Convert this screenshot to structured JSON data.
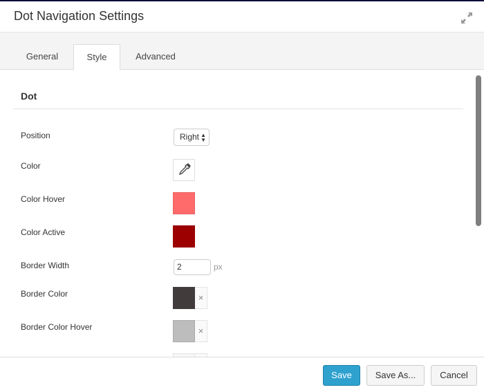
{
  "dialog": {
    "title": "Dot Navigation Settings",
    "expand_icon": "expand-arrows-icon"
  },
  "tabs": [
    {
      "label": "General",
      "active": false
    },
    {
      "label": "Style",
      "active": true
    },
    {
      "label": "Advanced",
      "active": false
    }
  ],
  "section": {
    "title": "Dot"
  },
  "fields": {
    "position": {
      "label": "Position",
      "value": "Right",
      "icon": "select-arrows-icon"
    },
    "color": {
      "label": "Color",
      "icon": "eyedropper-icon"
    },
    "color_hover": {
      "label": "Color Hover",
      "value": "#ff6b6b"
    },
    "color_active": {
      "label": "Color Active",
      "value": "#9c0000"
    },
    "border_width": {
      "label": "Border Width",
      "value": "2",
      "unit": "px"
    },
    "border_color": {
      "label": "Border Color",
      "value": "#423b3b",
      "clear": "×"
    },
    "border_color_hover": {
      "label": "Border Color Hover",
      "value": "#bdbdbd",
      "clear": "×"
    }
  },
  "footer": {
    "save_label": "Save",
    "save_as_label": "Save As...",
    "cancel_label": "Cancel"
  }
}
